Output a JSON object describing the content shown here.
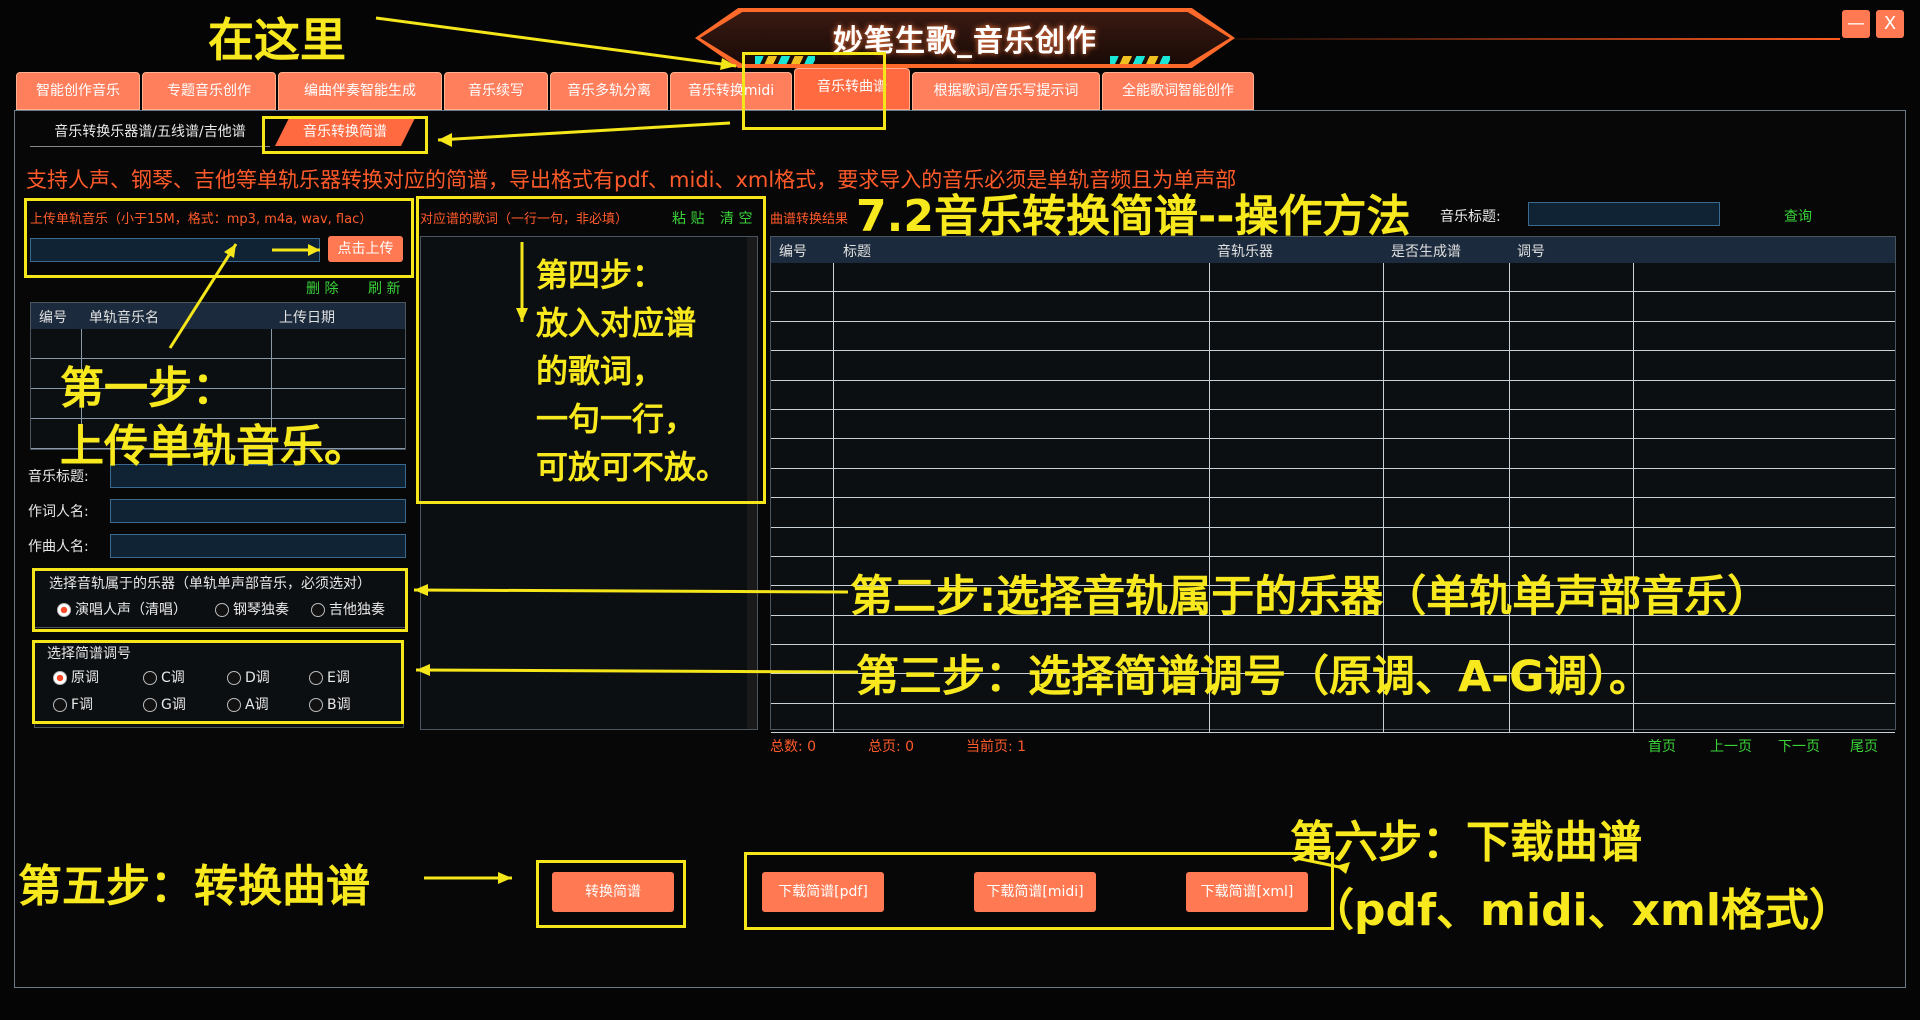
{
  "app": {
    "title": "妙笔生歌_音乐创作"
  },
  "window": {
    "minimize_label": "—",
    "close_label": "X"
  },
  "tabs": [
    "智能创作音乐",
    "专题音乐创作",
    "编曲伴奏智能生成",
    "音乐续写",
    "音乐多轨分离",
    "音乐转换midi",
    "音乐转曲谱",
    "根据歌词/音乐写提示词",
    "全能歌词智能创作"
  ],
  "subtabs": [
    "音乐转换乐器谱/五线谱/吉他谱",
    "音乐转换简谱"
  ],
  "info_text": "支持人声、钢琴、吉他等单轨乐器转换对应的简谱，导出格式有pdf、midi、xml格式，要求导入的音乐必须是单轨音频且为单声部",
  "upload": {
    "label": "上传单轨音乐（小于15M，格式：mp3, m4a, wav, flac）",
    "button": "点击上传",
    "delete": "删 除",
    "refresh": "刷 新"
  },
  "file_table": {
    "headers": [
      "编号",
      "单轨音乐名",
      "上传日期"
    ]
  },
  "fields": {
    "music_title": "音乐标题:",
    "lyricist": "作词人名:",
    "composer": "作曲人名:"
  },
  "instrument": {
    "title": "选择音轨属于的乐器（单轨单声部音乐，必须选对）",
    "options": [
      "演唱人声（清唱）",
      "钢琴独奏",
      "吉他独奏"
    ],
    "selected": "演唱人声（清唱）"
  },
  "key": {
    "title": "选择简谱调号",
    "options": [
      "原调",
      "C调",
      "D调",
      "E调",
      "F调",
      "G调",
      "A调",
      "B调"
    ],
    "selected": "原调"
  },
  "lyrics": {
    "label": "对应谱的歌词（一行一句，非必填）",
    "paste": "粘 贴",
    "clear": "清 空"
  },
  "results": {
    "label": "曲谱转换结果",
    "search_label": "音乐标题:",
    "search_btn": "查询",
    "headers": [
      "编号",
      "标题",
      "音轨乐器",
      "是否生成谱",
      "调号"
    ],
    "total": "总数: 0",
    "pages": "总页: 0",
    "current": "当前页: 1",
    "nav": [
      "首页",
      "上一页",
      "下一页",
      "尾页"
    ]
  },
  "actions": {
    "convert": "转换简谱",
    "dl_pdf": "下载简谱[pdf]",
    "dl_midi": "下载简谱[midi]",
    "dl_xml": "下载简谱[xml]"
  },
  "annotations": {
    "here": "在这里",
    "heading": "7.2音乐转换简谱--操作方法",
    "step1a": "第一步：",
    "step1b": "上传单轨音乐。",
    "step2": "第二步:选择音轨属于的乐器（单轨单声部音乐）",
    "step3": "第三步：选择简谱调号（原调、A-G调）。",
    "step4a": "第四步：",
    "step4b": "放入对应谱",
    "step4c": "的歌词，",
    "step4d": "一句一行，",
    "step4e": "可放可不放。",
    "step5": "第五步：转换曲谱",
    "step6a": "第六步：下载曲谱",
    "step6b": "（pdf、midi、xml格式）"
  },
  "colors": {
    "accent": "#ff7a52",
    "annotation": "#f5e61a",
    "info": "#ff5a2a",
    "link": "#3ad33a"
  }
}
